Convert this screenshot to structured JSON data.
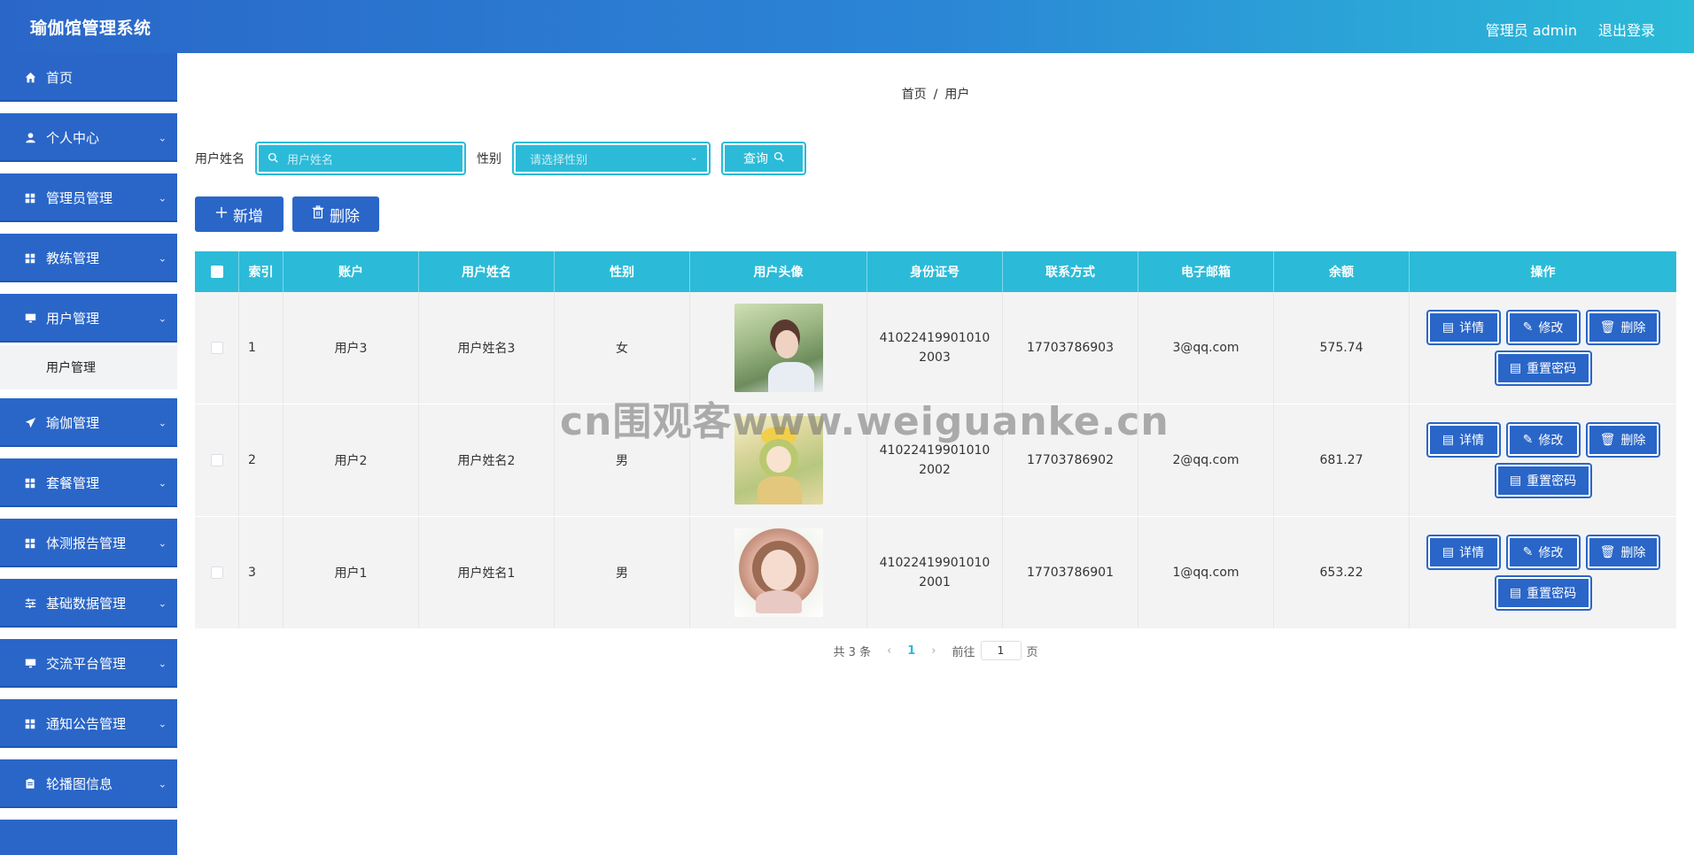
{
  "header": {
    "title": "瑜伽馆管理系统",
    "user_label": "管理员 admin",
    "logout_label": "退出登录"
  },
  "sidebar": {
    "items": [
      {
        "label": "首页",
        "icon": "home-icon",
        "has_children": false
      },
      {
        "label": "个人中心",
        "icon": "user-icon",
        "has_children": true
      },
      {
        "label": "管理员管理",
        "icon": "grid-icon",
        "has_children": true
      },
      {
        "label": "教练管理",
        "icon": "grid-icon",
        "has_children": true
      },
      {
        "label": "用户管理",
        "icon": "monitor-icon",
        "has_children": true
      },
      {
        "label": "瑜伽管理",
        "icon": "send-icon",
        "has_children": true
      },
      {
        "label": "套餐管理",
        "icon": "grid-icon",
        "has_children": true
      },
      {
        "label": "体测报告管理",
        "icon": "grid-icon",
        "has_children": true
      },
      {
        "label": "基础数据管理",
        "icon": "sliders-icon",
        "has_children": true
      },
      {
        "label": "交流平台管理",
        "icon": "monitor-icon",
        "has_children": true
      },
      {
        "label": "通知公告管理",
        "icon": "grid-icon",
        "has_children": true
      },
      {
        "label": "轮播图信息",
        "icon": "clipboard-icon",
        "has_children": true
      }
    ],
    "active_submenu": "用户管理"
  },
  "breadcrumb": {
    "home": "首页",
    "separator": "/",
    "current": "用户"
  },
  "search": {
    "name_label": "用户姓名",
    "name_placeholder": "用户姓名",
    "gender_label": "性别",
    "gender_placeholder": "请选择性别",
    "query_label": "查询"
  },
  "actions": {
    "add_label": "新增",
    "delete_label": "删除"
  },
  "table": {
    "headers": {
      "index": "索引",
      "account": "账户",
      "name": "用户姓名",
      "gender": "性别",
      "avatar": "用户头像",
      "id_number": "身份证号",
      "phone": "联系方式",
      "email": "电子邮箱",
      "balance": "余额",
      "ops": "操作"
    },
    "rows": [
      {
        "index": "1",
        "account": "用户3",
        "name": "用户姓名3",
        "gender": "女",
        "id_number": "410224199010102003",
        "phone": "17703786903",
        "email": "3@qq.com",
        "balance": "575.74"
      },
      {
        "index": "2",
        "account": "用户2",
        "name": "用户姓名2",
        "gender": "男",
        "id_number": "410224199010102002",
        "phone": "17703786902",
        "email": "2@qq.com",
        "balance": "681.27"
      },
      {
        "index": "3",
        "account": "用户1",
        "name": "用户姓名1",
        "gender": "男",
        "id_number": "410224199010102001",
        "phone": "17703786901",
        "email": "1@qq.com",
        "balance": "653.22"
      }
    ],
    "row_actions": {
      "detail": "详情",
      "edit": "修改",
      "delete": "删除",
      "reset_password": "重置密码"
    }
  },
  "pagination": {
    "total_text": "共 3 条",
    "current_page": "1",
    "goto_label": "前往",
    "goto_value": "1",
    "page_suffix": "页"
  },
  "watermark": "cn围观客www.weiguanke.cn",
  "colors": {
    "primary": "#2a66c8",
    "accent": "#2bbbd8",
    "row_bg": "#f3f3f3"
  }
}
